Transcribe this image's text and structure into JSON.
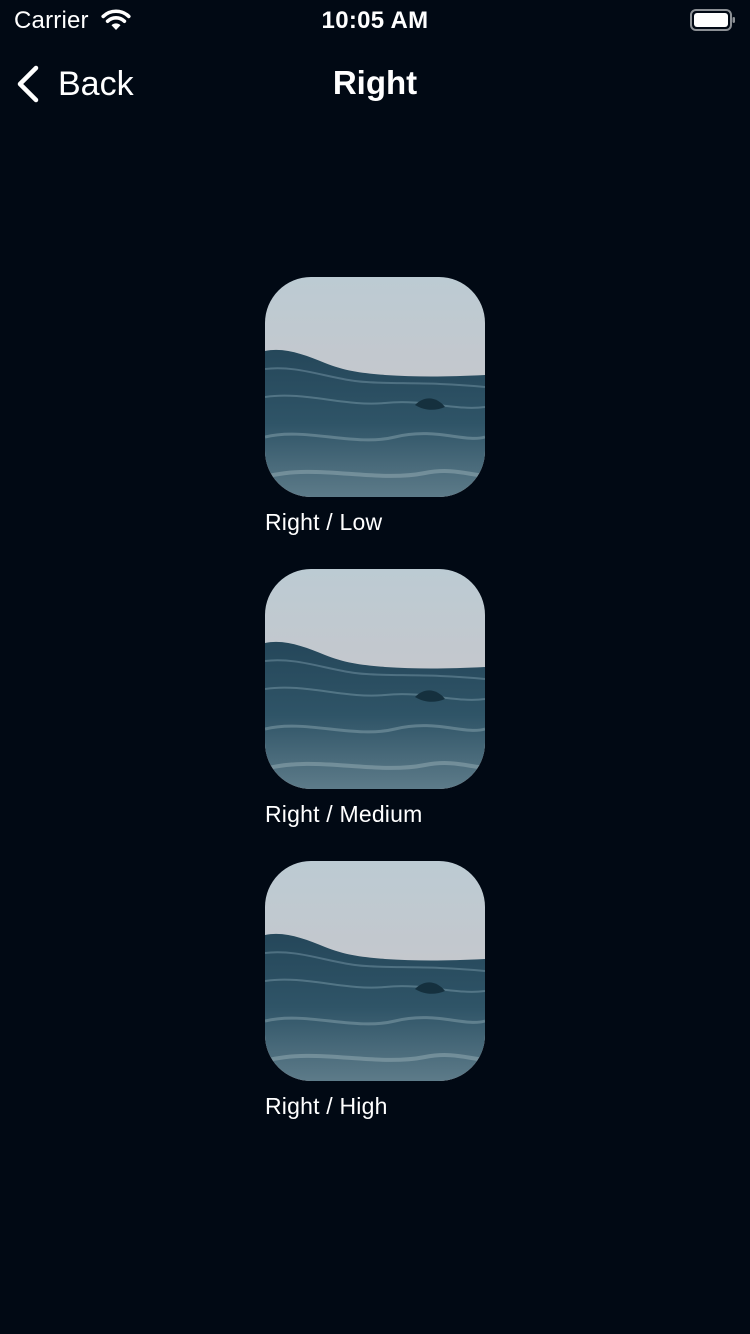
{
  "status_bar": {
    "carrier": "Carrier",
    "time": "10:05 AM",
    "wifi_icon": "wifi-icon",
    "battery_icon": "battery-icon"
  },
  "nav": {
    "back_label": "Back",
    "back_icon": "chevron-left-icon",
    "title": "Right"
  },
  "tiles": [
    {
      "label": "Right / Low",
      "image": "ocean-wave-image"
    },
    {
      "label": "Right / Medium",
      "image": "ocean-wave-image"
    },
    {
      "label": "Right / High",
      "image": "ocean-wave-image"
    }
  ],
  "colors": {
    "background": "#010914",
    "text": "#ffffff",
    "sky": "#b9c8d0",
    "water": "#2e4d5e"
  }
}
